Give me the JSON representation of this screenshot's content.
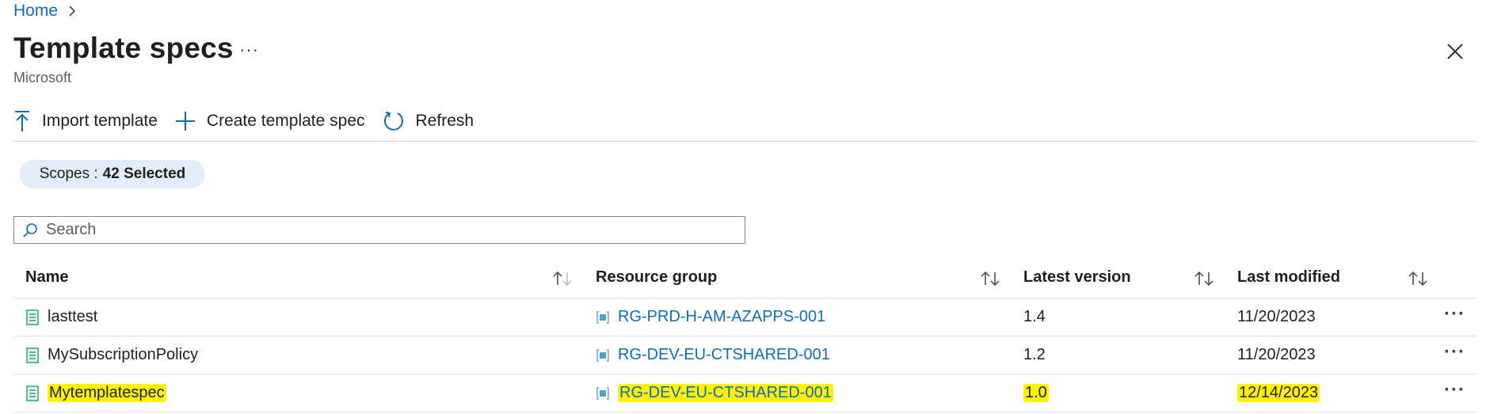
{
  "breadcrumb": {
    "home": "Home"
  },
  "header": {
    "title": "Template specs",
    "more": "···",
    "subtitle": "Microsoft"
  },
  "toolbar": {
    "import_label": "Import template",
    "create_label": "Create template spec",
    "refresh_label": "Refresh"
  },
  "scope": {
    "label": "Scopes :",
    "value": "42 Selected"
  },
  "search": {
    "placeholder": "Search",
    "value": ""
  },
  "table": {
    "columns": [
      "Name",
      "Resource group",
      "Latest version",
      "Last modified"
    ],
    "rows": [
      {
        "name": "lasttest",
        "resource_group": "RG-PRD-H-AM-AZAPPS-001",
        "version": "1.4",
        "modified": "11/20/2023",
        "highlighted": false
      },
      {
        "name": "MySubscriptionPolicy",
        "resource_group": "RG-DEV-EU-CTSHARED-001",
        "version": "1.2",
        "modified": "11/20/2023",
        "highlighted": false
      },
      {
        "name": "Mytemplatespec",
        "resource_group": "RG-DEV-EU-CTSHARED-001",
        "version": "1.0",
        "modified": "12/14/2023",
        "highlighted": true
      }
    ],
    "row_more": "···"
  },
  "colors": {
    "accent": "#0f6cbd",
    "highlight": "#fff200",
    "pill": "#e1eefa"
  },
  "icons": [
    "chevron-right-icon",
    "close-icon",
    "upload-icon",
    "plus-icon",
    "refresh-icon",
    "search-icon",
    "sort-icon",
    "template-spec-icon",
    "resource-group-icon",
    "more-icon"
  ]
}
